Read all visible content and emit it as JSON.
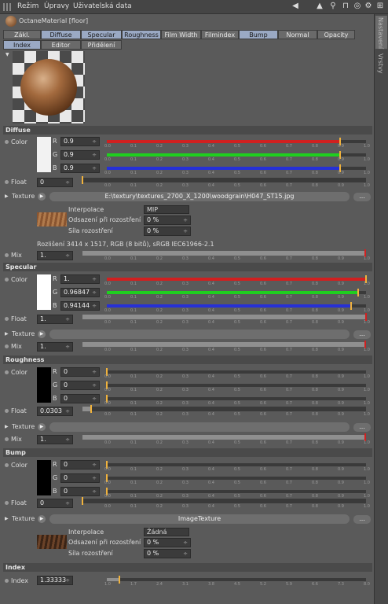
{
  "menu": {
    "mode": "Režim",
    "edit": "Úpravy",
    "userdata": "Uživatelská data"
  },
  "icons": [
    "arrow-left-icon",
    "arrow-up-icon",
    "search-icon",
    "lock-icon",
    "target-icon",
    "settings-icon",
    "add-icon"
  ],
  "side_tabs": [
    "Nastavení",
    "Vrstvy"
  ],
  "object_title": "OctaneMaterial [floor]",
  "tabs_row1": [
    "Zákl.",
    "Diffuse",
    "Specular",
    "Roughness",
    "Film Width",
    "Filmindex",
    "Bump",
    "Normal",
    "Opacity"
  ],
  "tabs_row1_active": [
    false,
    true,
    true,
    true,
    false,
    false,
    true,
    false,
    false
  ],
  "tabs_row2": [
    "Index",
    "Editor",
    "Přidělení"
  ],
  "ticks": [
    "0.0",
    "0.1",
    "0.2",
    "0.3",
    "0.4",
    "0.5",
    "0.6",
    "0.7",
    "0.8",
    "0.9",
    "1.0"
  ],
  "index_ticks": [
    "1.0",
    "1.7",
    "2.4",
    "3.1",
    "3.8",
    "4.5",
    "5.2",
    "5.9",
    "6.6",
    "7.3",
    "8.0"
  ],
  "labels": {
    "color": "Color",
    "float": "Float",
    "texture": "Texture",
    "mix": "Mix",
    "index": "Index",
    "r": "R",
    "g": "G",
    "b": "B",
    "dots": "...",
    "interp": "Interpolace",
    "offset": "Odsazení při rozostření",
    "strength": "Síla rozostření"
  },
  "diffuse": {
    "title": "Diffuse",
    "r": "0.9",
    "g": "0.9",
    "b": "0.9",
    "float": "0",
    "texture_path": "E:\\textury\\textures_2700_X_1200\\woodgrain\\H047_ST15.jpg",
    "interpolation": "MIP",
    "offset": "0 %",
    "strength": "0 %",
    "resolution": "Rozlišení 3414 x 1517, RGB (8 bitů), sRGB IEC61966-2.1",
    "mix": "1."
  },
  "specular": {
    "title": "Specular",
    "r": "1.",
    "g": "0.96847",
    "b": "0.94144",
    "float": "1.",
    "texture": "",
    "mix": "1."
  },
  "roughness": {
    "title": "Roughness",
    "r": "0",
    "g": "0",
    "b": "0",
    "float": "0.0303",
    "texture": "",
    "mix": "1."
  },
  "bump": {
    "title": "Bump",
    "r": "0",
    "g": "0",
    "b": "0",
    "float": "0",
    "texture": "ImageTexture",
    "interpolation": "Žádná",
    "offset": "0 %",
    "strength": "0 %"
  },
  "index": {
    "title": "Index",
    "value": "1.33333"
  },
  "values": {
    "diffuse": [
      0.9,
      0.9,
      0.9,
      0,
      1
    ],
    "specular": [
      1,
      0.96847,
      0.94144,
      1,
      1
    ],
    "roughness": [
      0,
      0,
      0,
      0.0303,
      1
    ],
    "bump": [
      0,
      0,
      0,
      0
    ],
    "index": 1.33333
  },
  "colors": {
    "red": "#d12020",
    "green": "#1fcf1f",
    "blue": "#2630d6",
    "gray": "#8f8f8f",
    "accent": "#9aa9c4",
    "marker": "#f0b23c"
  }
}
